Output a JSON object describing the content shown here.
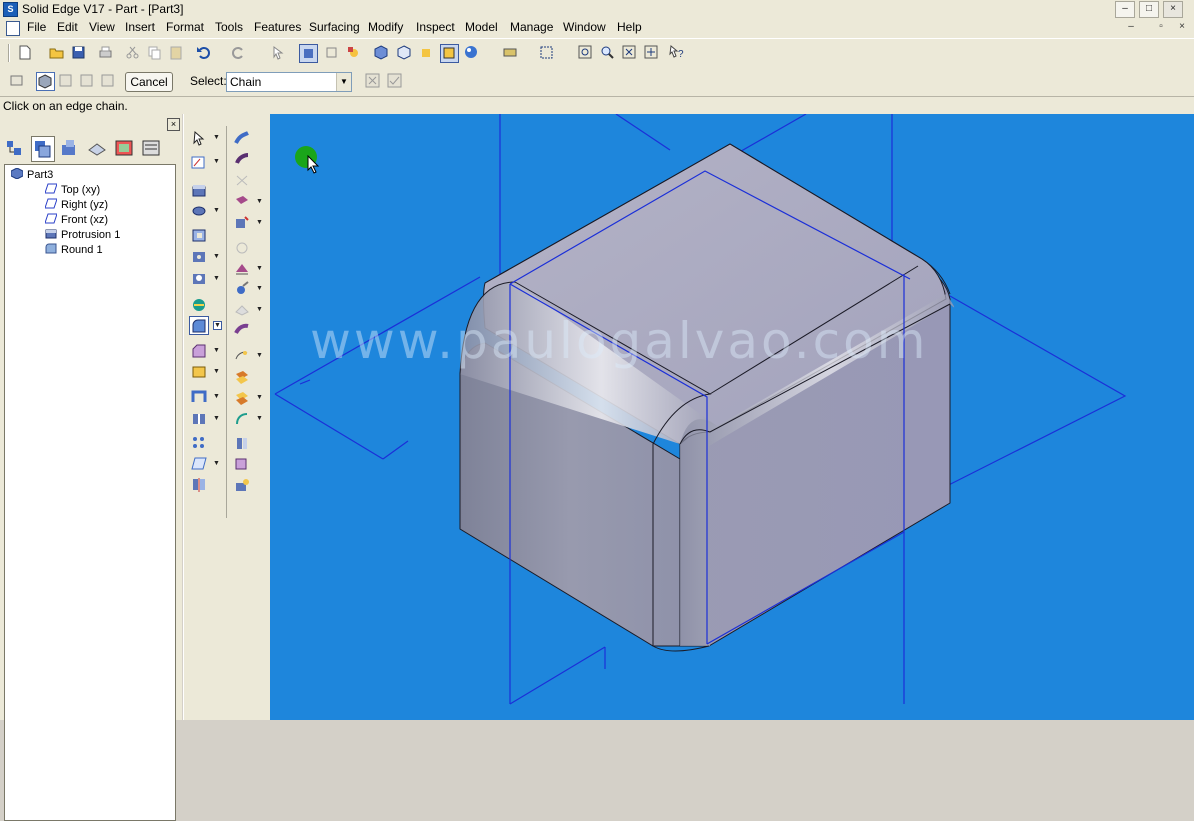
{
  "window": {
    "title": "Solid Edge V17 - Part - [Part3]",
    "controls": [
      "–",
      "□",
      "×"
    ],
    "mdi_controls": [
      "–",
      "▫",
      "×"
    ]
  },
  "menu": [
    "File",
    "Edit",
    "View",
    "Insert",
    "Format",
    "Tools",
    "Features",
    "Surfacing",
    "Modify",
    "Inspect",
    "Model",
    "Manage",
    "Window",
    "Help"
  ],
  "ribbon": {
    "cancel_label": "Cancel",
    "select_label": "Select:",
    "select_value": "Chain"
  },
  "status_prompt": "Click on an edge chain.",
  "pathfinder": {
    "close": "×",
    "tree": [
      {
        "label": "Part3",
        "icon": "part-icon"
      },
      {
        "label": "Top (xy)",
        "icon": "plane-icon"
      },
      {
        "label": "Right (yz)",
        "icon": "plane-icon"
      },
      {
        "label": "Front (xz)",
        "icon": "plane-icon"
      },
      {
        "label": "Protrusion 1",
        "icon": "protrusion-icon"
      },
      {
        "label": "Round 1",
        "icon": "round-icon"
      }
    ]
  },
  "viewport": {
    "background": "#1e86dc",
    "watermark": "www.paulogalvao.com"
  },
  "colors": {
    "chrome": "#ece9d8",
    "plane_lines": "#1b2fd8",
    "cursor_highlight": "#1aa51a"
  }
}
